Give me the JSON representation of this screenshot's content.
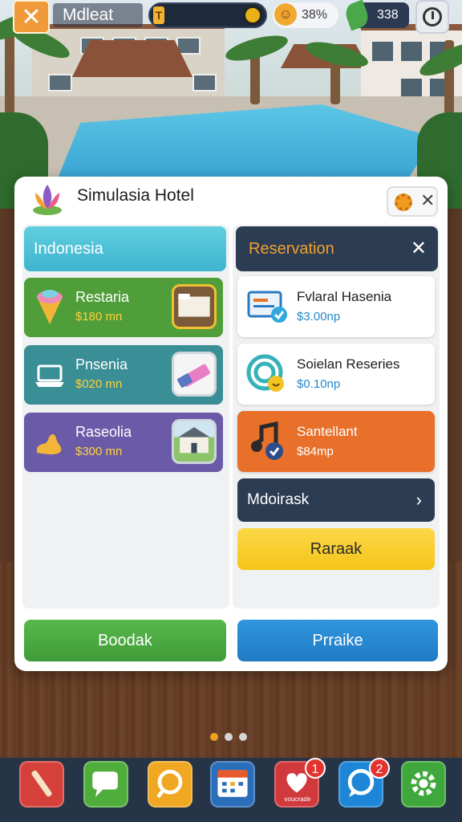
{
  "topbar": {
    "title": "Mdleat",
    "energy_icon_text": "T",
    "happiness": "38%",
    "leaf_count": "338"
  },
  "panel": {
    "hotel_name": "Simulasia Hotel",
    "left": {
      "header": "Indonesia",
      "cards": [
        {
          "title": "Restaria",
          "price": "$180 mn",
          "icon": "ice-cream-icon",
          "color": "#4f9e39"
        },
        {
          "title": "Pnsenia",
          "price": "$020 mn",
          "icon": "laptop-icon",
          "color": "#3a8e95"
        },
        {
          "title": "Raseolia",
          "price": "$300 mn",
          "icon": "map-icon",
          "color": "#6b5aa8"
        }
      ]
    },
    "right": {
      "header": "Reservation",
      "cards": [
        {
          "title": "Fvlaral Hasenia",
          "price": "$3.00np",
          "icon": "monitor-check-icon"
        },
        {
          "title": "Soielan Reseries",
          "price": "$0.10np",
          "icon": "target-icon"
        },
        {
          "title": "Santellant",
          "price": "$84mp",
          "icon": "music-check-icon"
        }
      ],
      "menu_label": "Mdoirask",
      "yellow_button": "Raraak"
    },
    "footer": {
      "green_button": "Boodak",
      "blue_button": "Prraike"
    }
  },
  "dock": {
    "apps": [
      {
        "name": "pencil-app",
        "color": "#d6403b"
      },
      {
        "name": "chat-app",
        "color": "#4fae3b"
      },
      {
        "name": "search-app",
        "color": "#f0a823"
      },
      {
        "name": "calendar-app",
        "color": "#2a6db8"
      },
      {
        "name": "heart-app",
        "color": "#d13a3c",
        "badge": "1",
        "label": "voucrade"
      },
      {
        "name": "message-app",
        "color": "#1e86d6",
        "badge": "2"
      },
      {
        "name": "settings-app",
        "color": "#3fa83c"
      }
    ]
  },
  "colors": {
    "accent_orange": "#f1a132",
    "panel_dark": "#2c3c52",
    "price_yellow": "#ffd23c",
    "price_blue": "#2688c8"
  }
}
